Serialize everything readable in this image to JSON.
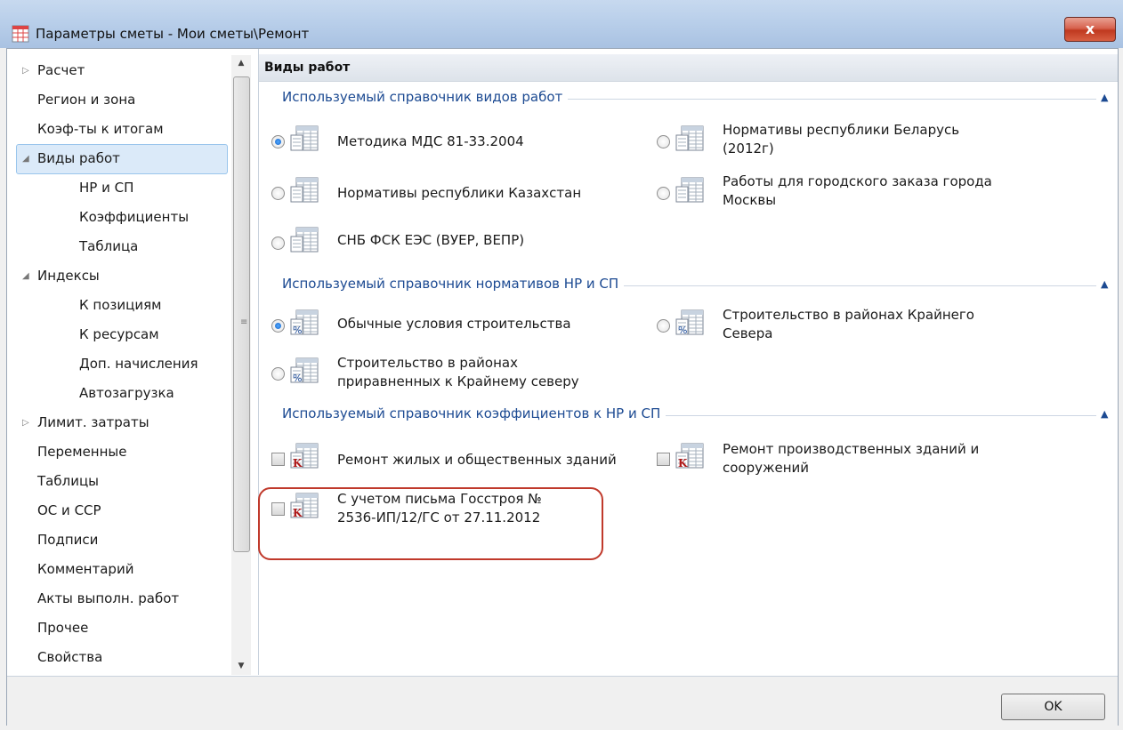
{
  "window": {
    "title": "Параметры сметы - Мои сметы\\Ремонт",
    "close_label": "x"
  },
  "sidebar": {
    "items": [
      {
        "label": "Расчет"
      },
      {
        "label": "Регион и зона"
      },
      {
        "label": "Коэф-ты к итогам"
      },
      {
        "label": "Виды работ"
      },
      {
        "label": "НР и СП"
      },
      {
        "label": "Коэффициенты"
      },
      {
        "label": "Таблица"
      },
      {
        "label": "Индексы"
      },
      {
        "label": "К позициям"
      },
      {
        "label": "К ресурсам"
      },
      {
        "label": "Доп. начисления"
      },
      {
        "label": "Автозагрузка"
      },
      {
        "label": "Лимит. затраты"
      },
      {
        "label": "Переменные"
      },
      {
        "label": "Таблицы"
      },
      {
        "label": "ОС и ССР"
      },
      {
        "label": "Подписи"
      },
      {
        "label": "Комментарий"
      },
      {
        "label": "Акты выполн. работ"
      },
      {
        "label": "Прочее"
      },
      {
        "label": "Свойства"
      }
    ],
    "selected": "Виды работ"
  },
  "main": {
    "header": "Виды работ",
    "sections": [
      {
        "title": "Используемый справочник видов работ",
        "options": [
          {
            "line1": "Методика МДС 81-33.2004",
            "line2": "",
            "selected": true
          },
          {
            "line1": "Нормативы республики Беларусь",
            "line2": "(2012г)",
            "selected": false
          },
          {
            "line1": "Нормативы республики Казахстан",
            "line2": "",
            "selected": false
          },
          {
            "line1": "Работы для городского заказа города",
            "line2": "Москвы",
            "selected": false
          },
          {
            "line1": "СНБ ФСК ЕЭС (ВУЕР, ВЕПР)",
            "line2": "",
            "selected": false
          }
        ]
      },
      {
        "title": "Используемый справочник нормативов НР и СП",
        "options": [
          {
            "line1": "Обычные условия строительства",
            "line2": "",
            "selected": true
          },
          {
            "line1": "Строительство в районах Крайнего",
            "line2": "Севера",
            "selected": false
          },
          {
            "line1": "Строительство в районах",
            "line2": "приравненных к Крайнему северу",
            "selected": false
          }
        ]
      },
      {
        "title": "Используемый справочник коэффициентов к НР и СП",
        "options": [
          {
            "line1": "Ремонт жилых и общественных зданий",
            "line2": "",
            "checked": false
          },
          {
            "line1": "Ремонт производственных зданий и",
            "line2": "сооружений",
            "checked": false
          },
          {
            "line1": "С учетом письма Госстроя №",
            "line2": "2536-ИП/12/ГС от 27.11.2012",
            "checked": false
          }
        ]
      }
    ]
  },
  "footer": {
    "ok_label": "OK"
  },
  "icons": {
    "app": "grid-app-icon",
    "reference_book": "table-document-icon",
    "percent_book": "percent-table-icon",
    "coeff_book": "k-table-icon"
  },
  "colors": {
    "section_title": "#1c4a92",
    "highlight": "#c0392b",
    "selection": "#dbeaf9"
  }
}
